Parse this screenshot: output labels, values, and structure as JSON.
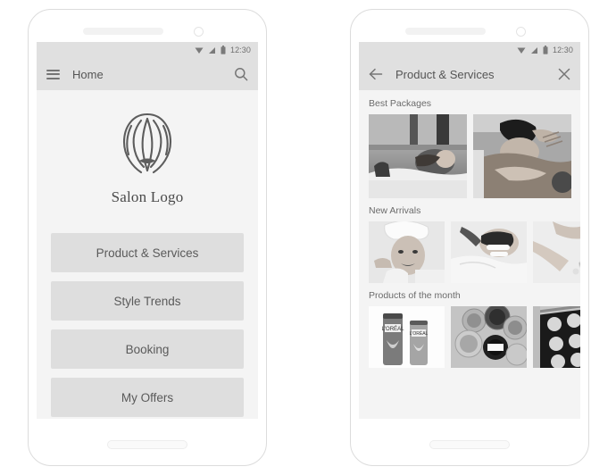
{
  "phones": {
    "left": {
      "name": "home-screen",
      "statusbar": {
        "time": "12:30",
        "icons": [
          "wifi-icon",
          "signal-icon",
          "battery-icon"
        ]
      },
      "appbar": {
        "menu_icon": "hamburger-menu-icon",
        "title": "Home",
        "action_icon": "search-icon"
      },
      "logo": {
        "icon": "salon-hair-logo-icon",
        "text": "Salon Logo"
      },
      "menu_buttons": [
        {
          "label": "Product & Services"
        },
        {
          "label": "Style Trends"
        },
        {
          "label": "Booking"
        },
        {
          "label": "My Offers"
        }
      ]
    },
    "right": {
      "name": "product-services-screen",
      "statusbar": {
        "time": "12:30",
        "icons": [
          "wifi-icon",
          "signal-icon",
          "battery-icon"
        ]
      },
      "appbar": {
        "back_icon": "back-arrow-icon",
        "title": "Product & Services",
        "action_icon": "close-icon"
      },
      "sections": [
        {
          "title": "Best Packages",
          "size": "large",
          "tiles": [
            {
              "alt": "hair-washing-salon-photo"
            },
            {
              "alt": "back-massage-photo"
            }
          ]
        },
        {
          "title": "New Arrivals",
          "size": "small",
          "tiles": [
            {
              "alt": "woman-with-towel-facial-photo"
            },
            {
              "alt": "facial-mask-treatment-photo"
            },
            {
              "alt": "arm-spa-treatment-photo"
            }
          ]
        },
        {
          "title": "Products of the month",
          "size": "small",
          "tiles": [
            {
              "alt": "loreal-shampoo-bottles-photo"
            },
            {
              "alt": "makeup-pots-photo"
            },
            {
              "alt": "makeup-palette-photo"
            }
          ]
        }
      ]
    }
  },
  "colors": {
    "screen_bg": "#f4f4f4",
    "appbar_bg": "#e0e0e0",
    "button_bg": "#dedede",
    "text_primary": "#555555",
    "text_secondary": "#6b6b6b",
    "frame_border": "#dcdcdc"
  }
}
